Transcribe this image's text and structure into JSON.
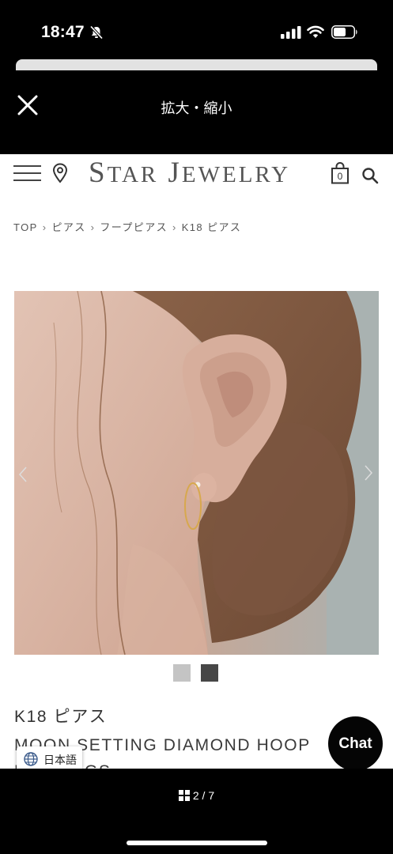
{
  "status_bar": {
    "time": "18:47",
    "icons": [
      "bell-slash-icon",
      "cellular-signal-icon",
      "wifi-icon",
      "battery-icon"
    ]
  },
  "modal": {
    "title": "拡大・縮小",
    "close_icon": "close-icon"
  },
  "site": {
    "brand": {
      "initial_1": "S",
      "rest_1": "TAR",
      "initial_2": "J",
      "rest_2": "EWELRY"
    },
    "nav_icons": [
      "hamburger-menu-icon",
      "location-pin-icon",
      "shopping-bag-icon",
      "search-icon"
    ],
    "cart_count": "0",
    "breadcrumb": [
      "TOP",
      "ピアス",
      "フープピアス",
      "K18 ピアス"
    ],
    "breadcrumb_separator": "›",
    "product": {
      "category": "K18 ピアス",
      "name": "MOON SETTING DIAMOND HOOP EARRINGS",
      "gallery_thumbs": 2
    },
    "language": "日本語",
    "chat_label": "Chat"
  },
  "pager": {
    "current": "2",
    "total": "7",
    "text": "2 / 7"
  },
  "colors": {
    "background": "#000000",
    "site_background": "#ffffff",
    "brand_gray": "#555555",
    "thumb_inactive": "#c4c4c4",
    "thumb_active": "#474747"
  }
}
